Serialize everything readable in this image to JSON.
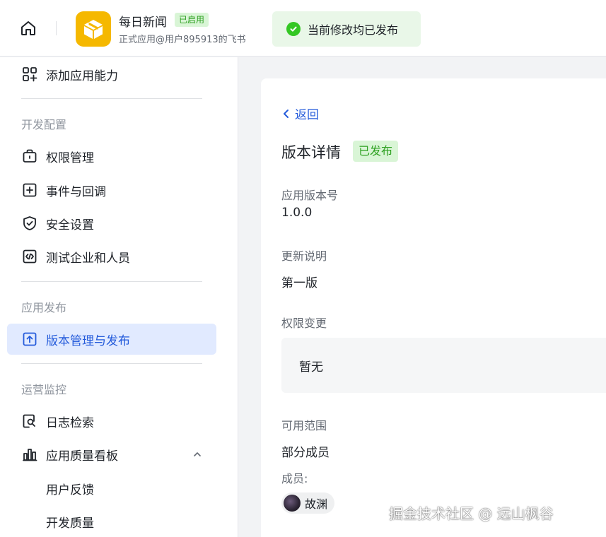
{
  "header": {
    "app_name": "每日新闻",
    "app_status": "已启用",
    "app_subtitle": "正式应用@用户895913的飞书",
    "toast": "当前修改均已发布"
  },
  "sidebar": {
    "add_capability": "添加应用能力",
    "sections": {
      "dev_config": "开发配置",
      "publish": "应用发布",
      "monitor": "运营监控"
    },
    "items": {
      "permissions": "权限管理",
      "events": "事件与回调",
      "security": "安全设置",
      "test_enterprise": "测试企业和人员",
      "version_publish": "版本管理与发布",
      "log_search": "日志检索",
      "quality_board": "应用质量看板",
      "feedback": "用户反馈",
      "dev_quality": "开发质量"
    }
  },
  "content": {
    "back": "返回",
    "title": "版本详情",
    "status_badge": "已发布",
    "version_label": "应用版本号",
    "version_value": "1.0.0",
    "notes_label": "更新说明",
    "notes_value": "第一版",
    "perm_change_label": "权限变更",
    "perm_change_value": "暂无",
    "scope_label": "可用范围",
    "scope_value": "部分成员",
    "members_label": "成员:",
    "member_name": "故渊"
  },
  "watermark": "掘金技术社区 @ 远山枫谷",
  "colors": {
    "accent": "#245bdb",
    "active_bg": "#e1eaff",
    "success": "#2ea121",
    "success_bg": "#d9f5d6",
    "app_logo": "#f5b800"
  }
}
